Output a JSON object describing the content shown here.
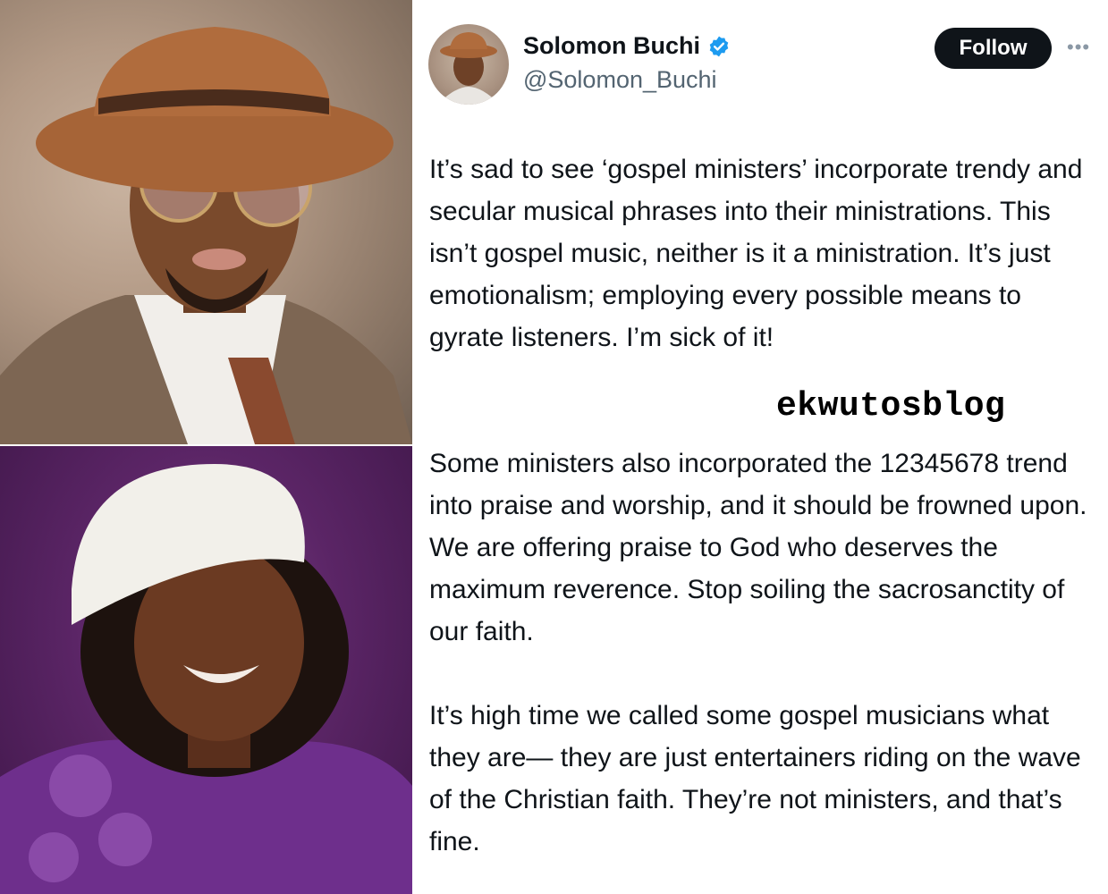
{
  "tweet": {
    "author_name": "Solomon Buchi",
    "author_handle": "@Solomon_Buchi",
    "follow_label": "Follow",
    "more_label": "•••",
    "paragraphs": [
      "It’s sad to see ‘gospel ministers’ incorporate trendy and secular musical phrases into their ministrations. This isn’t gospel music, neither is it a ministration. It’s just emotionalism; employing every possible means to gyrate listeners. I’m sick of it!",
      "Some ministers also incorporated the 12345678 trend into praise and worship, and it should be frowned upon. We are offering praise to God who deserves the maximum reverence. Stop soiling the sacrosanctity of our faith.",
      "It’s high time we called some gospel musicians what they are— they are just entertainers riding on the wave of the Christian faith. They’re not ministers, and that’s fine."
    ]
  },
  "watermark": "ekwutosblog",
  "icons": {
    "verified": "verified-badge-icon",
    "more": "more-options-icon"
  },
  "colors": {
    "follow_bg": "#0f1419",
    "verified_blue": "#1d9bf0",
    "handle_gray": "#536471",
    "text": "#0f1419",
    "bottom_photo_purple": "#5b2566"
  }
}
